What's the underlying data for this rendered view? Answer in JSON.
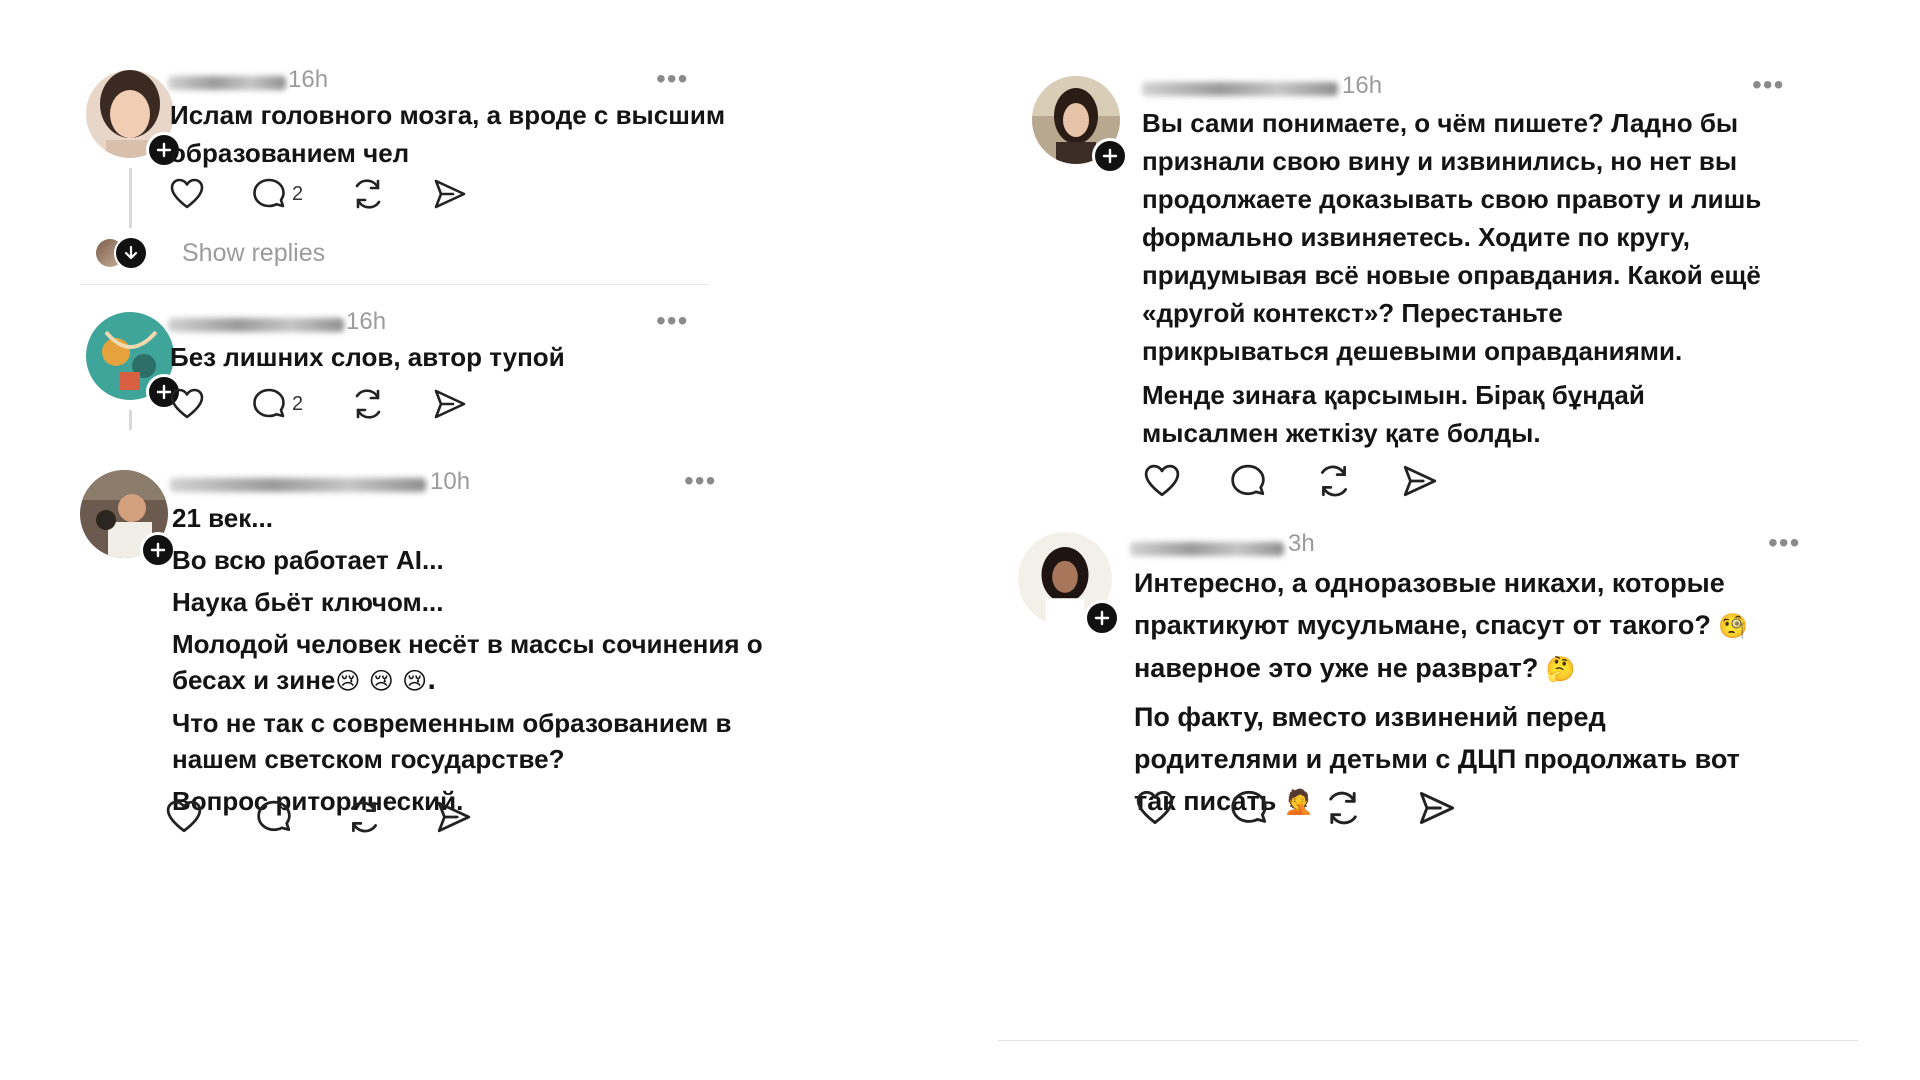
{
  "left_column": {
    "posts": [
      {
        "time": "16h",
        "lines": [
          "Ислам головного мозга, а вроде с высшим",
          "образованием чел"
        ],
        "reply_count": "2",
        "show_replies": "Show replies"
      },
      {
        "time": "16h",
        "lines": [
          "Без лишних слов, автор тупой"
        ],
        "reply_count": "2"
      },
      {
        "time": "10h",
        "lines": [
          "21 век...",
          "Во всю работает AI...",
          "Наука бьёт ключом...",
          "Молодой человек несёт в массы сочинения о",
          "бесах и зине",
          "Что не так с современным образованием в",
          "нашем светском государстве?",
          "Вопрос риторический."
        ],
        "emojis_after_line_5": "😢 😢 😢."
      }
    ]
  },
  "right_column": {
    "posts": [
      {
        "time": "16h",
        "lines": [
          "Вы сами понимаете, о чём пишете? Ладно бы",
          "признали свою вину и извинились, но нет вы",
          "продолжаете доказывать свою правоту и лишь",
          "формально извиняетесь. Ходите по кругу,",
          "придумывая всё новые оправдания. Какой ещё",
          "«другой контекст»? Перестаньте",
          "прикрываться дешевыми оправданиями.",
          "Менде зинаға қарсымын. Бірақ бұндай",
          "мысалмен жеткізу қате болды."
        ]
      },
      {
        "time": "3h",
        "lines": [
          "Интересно, а одноразовые никахи, которые",
          "практикуют мусульмане, спасут от такого?",
          "наверное это уже не разврат?",
          "По факту, вместо извинений перед",
          "родителями и детьми с ДЦП продолжать вот",
          "так писать"
        ],
        "emoji_line_2": "🧐",
        "emoji_line_3": "🤔",
        "emoji_line_6": "🤦"
      }
    ]
  },
  "icons": [
    "heart-icon",
    "comment-icon",
    "repost-icon",
    "share-icon",
    "more-icon",
    "plus-icon",
    "arrow-down-icon"
  ],
  "colors": {
    "text": "#141414",
    "muted": "#9b9b9b",
    "divider": "#e5e5e5",
    "badge": "#111111"
  }
}
